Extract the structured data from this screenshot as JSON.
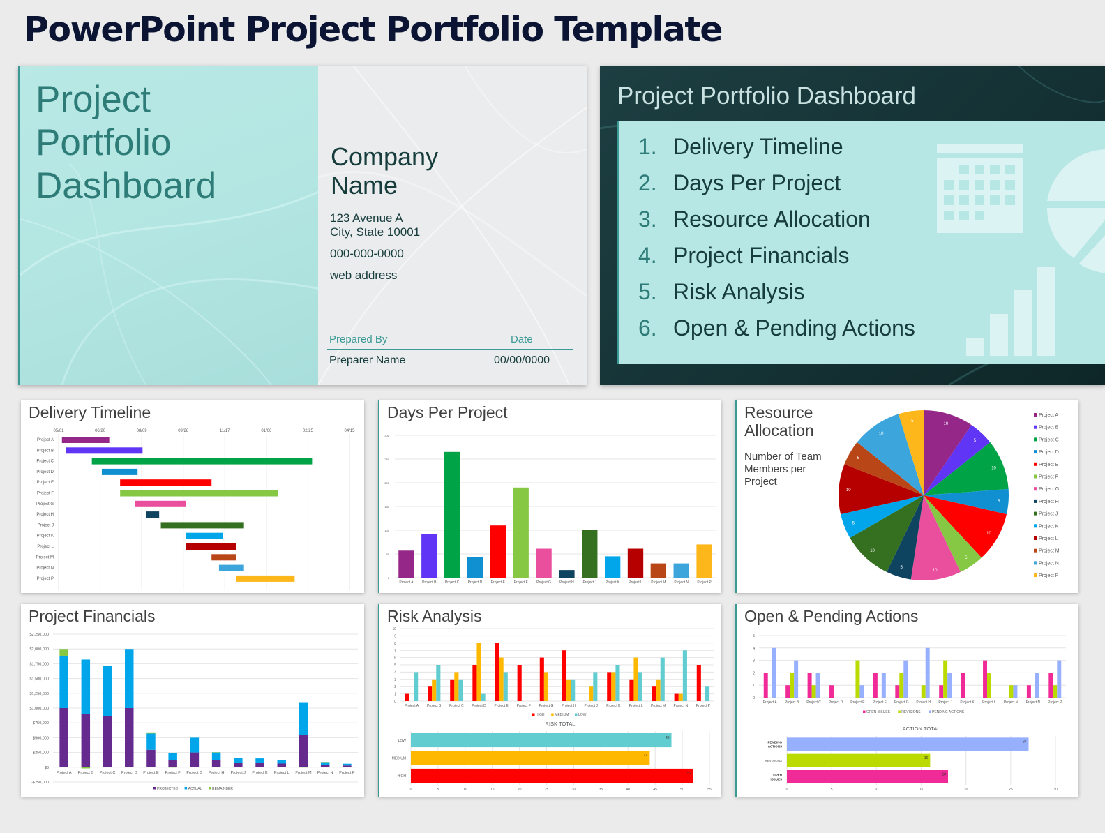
{
  "page": {
    "title": "PowerPoint Project Portfolio Template"
  },
  "title_slide": {
    "title_lines": [
      "Project",
      "Portfolio",
      "Dashboard"
    ],
    "company_lines": [
      "Company",
      "Name"
    ],
    "address_line1": "123 Avenue A",
    "address_line2": "City, State  10001",
    "phone": "000-000-0000",
    "web": "web address",
    "prepared_by_label": "Prepared By",
    "date_label": "Date",
    "preparer_name": "Preparer Name",
    "date_value": "00/00/0000",
    "colors": {
      "panel": "#b6e7e5",
      "accent": "#3b9a96",
      "title_text": "#2e7c78"
    }
  },
  "agenda_slide": {
    "title": "Project Portfolio Dashboard",
    "items": [
      {
        "num": "1.",
        "label": "Delivery Timeline"
      },
      {
        "num": "2.",
        "label": "Days Per Project"
      },
      {
        "num": "3.",
        "label": "Resource Allocation"
      },
      {
        "num": "4.",
        "label": "Project Financials"
      },
      {
        "num": "5.",
        "label": "Risk Analysis"
      },
      {
        "num": "6.",
        "label": "Open & Pending Actions"
      }
    ],
    "decor_icons": [
      "calendar-icon",
      "pie-chart-icon",
      "bar-chart-icon"
    ]
  },
  "projects": [
    "Project A",
    "Project B",
    "Project C",
    "Project D",
    "Project E",
    "Project F",
    "Project G",
    "Project H",
    "Project J",
    "Project K",
    "Project L",
    "Project M",
    "Project N",
    "Project P"
  ],
  "project_colors": [
    "#942788",
    "#6135f5",
    "#00a447",
    "#1190d1",
    "#ff0000",
    "#86c844",
    "#ea4f9e",
    "#0f4461",
    "#357021",
    "#00a5ea",
    "#b60000",
    "#b94616",
    "#3ca6dc",
    "#fdb71a"
  ],
  "chart_data": [
    {
      "id": "delivery_timeline",
      "type": "gantt",
      "title": "Delivery Timeline",
      "x_tick_labels": [
        "05/01",
        "06/20",
        "08/09",
        "09/28",
        "11/17",
        "01/06",
        "02/25",
        "04/15"
      ],
      "x_unit": "days from 05/01",
      "xlim": [
        0,
        350
      ],
      "grid": true,
      "tasks": [
        {
          "name": "Project A",
          "start": 4,
          "duration": 57
        },
        {
          "name": "Project B",
          "start": 9,
          "duration": 92
        },
        {
          "name": "Project C",
          "start": 40,
          "duration": 265
        },
        {
          "name": "Project D",
          "start": 52,
          "duration": 43
        },
        {
          "name": "Project E",
          "start": 74,
          "duration": 110
        },
        {
          "name": "Project F",
          "start": 74,
          "duration": 190
        },
        {
          "name": "Project G",
          "start": 92,
          "duration": 61
        },
        {
          "name": "Project H",
          "start": 105,
          "duration": 16
        },
        {
          "name": "Project J",
          "start": 123,
          "duration": 100
        },
        {
          "name": "Project K",
          "start": 153,
          "duration": 45
        },
        {
          "name": "Project L",
          "start": 153,
          "duration": 61
        },
        {
          "name": "Project M",
          "start": 184,
          "duration": 30
        },
        {
          "name": "Project N",
          "start": 193,
          "duration": 30
        },
        {
          "name": "Project P",
          "start": 214,
          "duration": 70
        }
      ]
    },
    {
      "id": "days_per_project",
      "type": "bar",
      "title": "Days Per Project",
      "categories": [
        "Project A",
        "Project B",
        "Project C",
        "Project D",
        "Project E",
        "Project F",
        "Project G",
        "Project H",
        "Project J",
        "Project K",
        "Project L",
        "Project M",
        "Project N",
        "Project P"
      ],
      "values": [
        57,
        92,
        265,
        43,
        110,
        190,
        61,
        16,
        100,
        45,
        61,
        30,
        30,
        70
      ],
      "ylim": [
        0,
        300
      ],
      "y_ticks": [
        0,
        50,
        100,
        150,
        200,
        250,
        300
      ],
      "grid": true
    },
    {
      "id": "resource_allocation",
      "type": "pie",
      "title": "Resource Allocation",
      "subtitle": "Number of Team Members per Project",
      "labels": [
        "Project A",
        "Project B",
        "Project C",
        "Project D",
        "Project E",
        "Project F",
        "Project G",
        "Project H",
        "Project J",
        "Project K",
        "Project L",
        "Project M",
        "Project N",
        "Project P"
      ],
      "values": [
        10,
        5,
        10,
        5,
        10,
        5,
        10,
        5,
        10,
        5,
        10,
        5,
        10,
        5
      ],
      "legend": "right"
    },
    {
      "id": "project_financials",
      "type": "bar",
      "stacked": true,
      "title": "Project Financials",
      "categories": [
        "Project A",
        "Project B",
        "Project C",
        "Project D",
        "Project E",
        "Project F",
        "Project G",
        "Project H",
        "Project J",
        "Project K",
        "Project L",
        "Project M",
        "Project N",
        "Project P"
      ],
      "series": [
        {
          "name": "PROJECTED",
          "color": "#652a8e",
          "values": [
            1000000,
            900000,
            860000,
            1000000,
            295000,
            120000,
            250000,
            125000,
            80000,
            75000,
            62500,
            550000,
            45000,
            30000
          ]
        },
        {
          "name": "ACTUAL",
          "color": "#00a5ea",
          "values": [
            880000,
            920000,
            850000,
            1000000,
            275000,
            125000,
            250000,
            125000,
            75000,
            75000,
            62500,
            550000,
            40000,
            30000
          ]
        },
        {
          "name": "REMAINDER",
          "color": "#86c844",
          "values": [
            120000,
            -20000,
            10000,
            0,
            20000,
            -5000,
            0,
            5000,
            5000,
            0,
            0,
            -5000,
            5000,
            0
          ]
        }
      ],
      "ylim": [
        -250000,
        2250000
      ],
      "y_tick_labels": [
        "-$250,000",
        "$0",
        "$250,000",
        "$500,000",
        "$750,000",
        "$1,000,000",
        "$1,250,000",
        "$1,500,000",
        "$1,750,000",
        "$2,000,000",
        "$2,250,000"
      ],
      "legend": "bottom",
      "grid": true
    },
    {
      "id": "risk_analysis",
      "type": "bar",
      "title": "Risk Analysis",
      "categories": [
        "Project A",
        "Project B",
        "Project C",
        "Project D",
        "Project E",
        "Project F",
        "Project G",
        "Project H",
        "Project J",
        "Project K",
        "Project L",
        "Project M",
        "Project N",
        "Project P"
      ],
      "series": [
        {
          "name": "HIGH",
          "color": "#ff0000",
          "values": [
            1,
            2,
            3,
            5,
            8,
            5,
            6,
            7,
            0,
            4,
            3,
            2,
            1,
            5
          ]
        },
        {
          "name": "MEDIUM",
          "color": "#ffb800",
          "values": [
            0,
            3,
            4,
            8,
            6,
            0,
            4,
            3,
            2,
            4,
            6,
            3,
            1,
            0
          ]
        },
        {
          "name": "LOW",
          "color": "#62cdd0",
          "values": [
            4,
            5,
            3,
            1,
            4,
            0,
            0,
            3,
            4,
            5,
            4,
            6,
            7,
            2
          ]
        }
      ],
      "ylim": [
        0,
        10
      ],
      "legend": "bottom",
      "grid": true
    },
    {
      "id": "risk_total",
      "type": "bar",
      "orientation": "horizontal",
      "title": "RISK TOTAL",
      "categories": [
        "LOW",
        "MEDIUM",
        "HIGH"
      ],
      "values": [
        48,
        44,
        52
      ],
      "colors": [
        "#62cdd0",
        "#ffb800",
        "#ff0000"
      ],
      "xlim": [
        0,
        55
      ],
      "x_ticks": [
        0,
        5,
        10,
        15,
        20,
        25,
        30,
        35,
        40,
        45,
        50,
        55
      ]
    },
    {
      "id": "open_pending_actions",
      "type": "bar",
      "title": "Open & Pending Actions",
      "categories": [
        "Project A",
        "Project B",
        "Project C",
        "Project D",
        "Project E",
        "Project F",
        "Project G",
        "Project H",
        "Project J",
        "Project K",
        "Project L",
        "Project M",
        "Project N",
        "Project P"
      ],
      "series": [
        {
          "name": "OPEN ISSUES",
          "color": "#f02b97",
          "values": [
            2,
            1,
            2,
            1,
            0,
            2,
            1,
            0,
            1,
            2,
            3,
            0,
            1,
            2
          ]
        },
        {
          "name": "REVISIONS",
          "color": "#bada00",
          "values": [
            0,
            2,
            1,
            0,
            3,
            0,
            2,
            1,
            3,
            0,
            2,
            1,
            0,
            1
          ]
        },
        {
          "name": "PENDING ACTIONS",
          "color": "#97b0fd",
          "values": [
            4,
            3,
            2,
            0,
            1,
            2,
            3,
            4,
            2,
            0,
            0,
            1,
            2,
            3
          ]
        }
      ],
      "ylim": [
        0,
        5
      ],
      "legend": "bottom",
      "grid": true
    },
    {
      "id": "action_total",
      "type": "bar",
      "orientation": "horizontal",
      "title": "ACTION TOTAL",
      "categories": [
        "PENDING ACTIONS",
        "REVISIONS",
        "OPEN ISSUES"
      ],
      "values": [
        27,
        16,
        18
      ],
      "colors": [
        "#97b0fd",
        "#bada00",
        "#f02b97"
      ],
      "xlim": [
        0,
        30
      ],
      "x_ticks": [
        0,
        5,
        10,
        15,
        20,
        25,
        30
      ]
    }
  ]
}
